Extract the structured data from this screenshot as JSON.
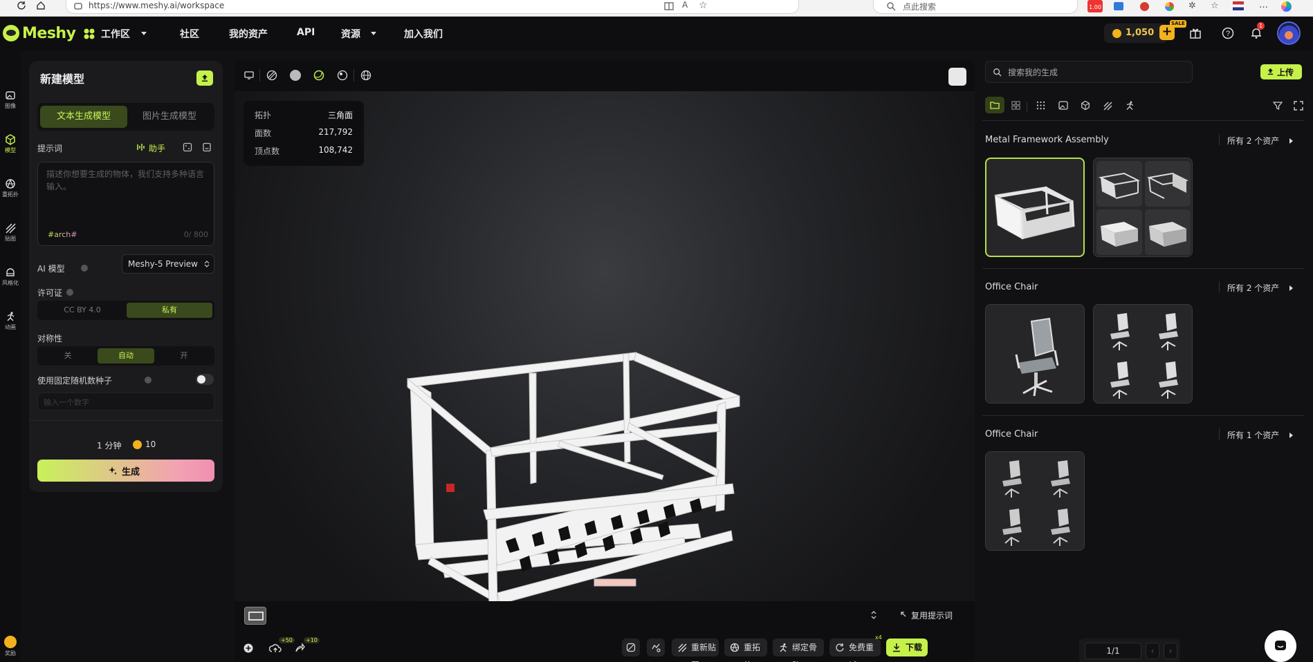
{
  "browser": {
    "url": "https://www.meshy.ai/workspace",
    "search_placeholder": "点此搜索",
    "badge_price": "1.00"
  },
  "header": {
    "logo": "Meshy",
    "nav": {
      "workspace": "工作区",
      "community": "社区",
      "assets": "我的资产",
      "api": "API",
      "resources": "资源",
      "join": "加入我们"
    },
    "credits": "1,050",
    "sale_badge": "SALE",
    "notification_count": "1"
  },
  "rail": {
    "items": [
      {
        "label": "图像",
        "icon": "image-icon"
      },
      {
        "label": "模型",
        "icon": "cube-icon"
      },
      {
        "label": "重拓扑",
        "icon": "retopology-icon"
      },
      {
        "label": "贴图",
        "icon": "texture-icon"
      },
      {
        "label": "风格化",
        "icon": "stylize-icon"
      },
      {
        "label": "动画",
        "icon": "animate-icon"
      }
    ],
    "bottom_label": "奖励"
  },
  "left_panel": {
    "title": "新建模型",
    "tabs": {
      "text_to_model": "文本生成模型",
      "image_to_model": "图片生成模型"
    },
    "prompt_label": "提示词",
    "assistant_label": "助手",
    "prompt_placeholder": "描述你想要生成的物体，我们支持多种语言输入。",
    "prompt_tag": "#arch#",
    "prompt_counter": "0/ 800",
    "ai_model_label": "AI 模型",
    "ai_model_value": "Meshy-5 Preview",
    "license_label": "许可证",
    "license_options": {
      "cc": "CC BY 4.0",
      "private": "私有"
    },
    "symmetry_label": "对称性",
    "symmetry_options": {
      "off": "关",
      "auto": "自动",
      "on": "开"
    },
    "seed_label": "使用固定随机数种子",
    "seed_placeholder": "输入一个数字",
    "time": "1 分钟",
    "cost": "10",
    "generate_label": "生成"
  },
  "viewer": {
    "stats": {
      "topology_label": "拓扑",
      "topology_value": "三角面",
      "faces_label": "面数",
      "faces_value": "217,792",
      "vertices_label": "顶点数",
      "vertices_value": "108,742"
    },
    "reuse_prompt": "复用提示词",
    "bonus_a": "+50",
    "bonus_b": "+10",
    "actions": {
      "retexture": "重新贴图",
      "remesh": "重拓扑",
      "rig": "绑定骨骼",
      "retry": "免费重试",
      "retry_badge": "x4",
      "download": "下载"
    }
  },
  "right_panel": {
    "search_placeholder": "搜索我的生成",
    "upload_label": "上传",
    "groups": [
      {
        "title": "Metal Framework Assembly",
        "all": "所有 2 个资产"
      },
      {
        "title": "Office Chair",
        "all": "所有 2 个资产"
      },
      {
        "title": "Office Chair",
        "all": "所有 1 个资产"
      }
    ],
    "pagination": "1/1"
  }
}
